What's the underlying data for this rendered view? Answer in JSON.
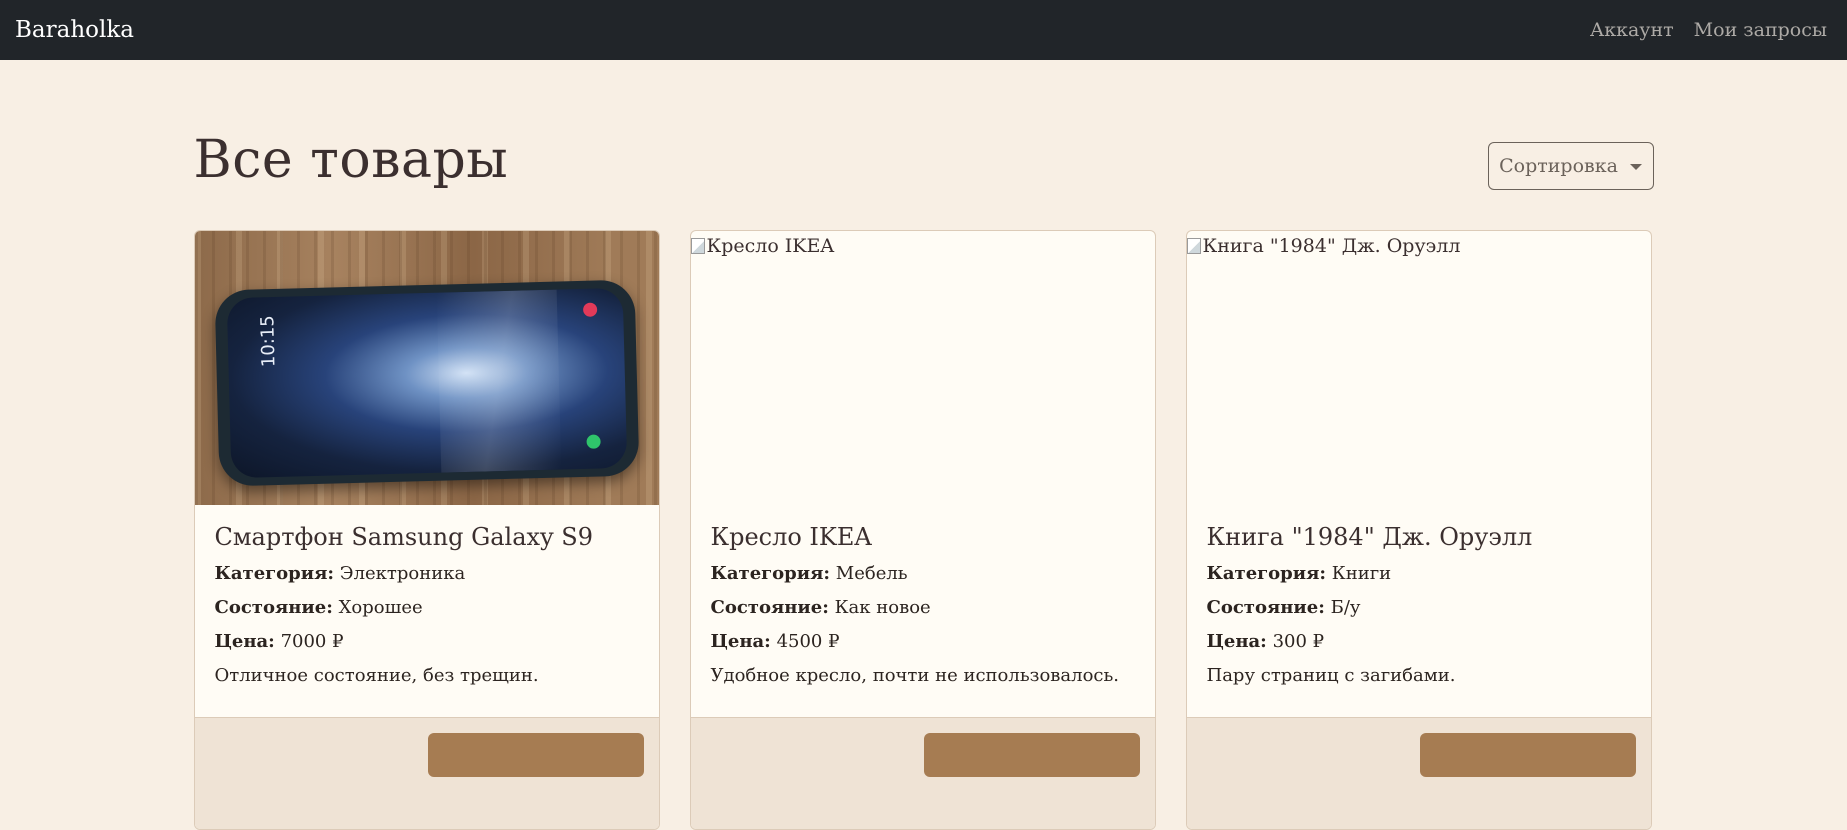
{
  "navbar": {
    "brand": "Baraholka",
    "links": [
      "Аккаунт",
      "Мои запросы"
    ]
  },
  "page": {
    "title": "Все товары",
    "sort_label": "Сортировка"
  },
  "labels": {
    "category": "Категория:",
    "condition": "Состояние:",
    "price": "Цена:"
  },
  "products": [
    {
      "title": "Смартфон Samsung Galaxy S9",
      "category": "Электроника",
      "condition": "Хорошее",
      "price": "7000 ₽",
      "description": "Отличное состояние, без трещин.",
      "image_alt": "",
      "screen_time": "10:15"
    },
    {
      "title": "Кресло IKEA",
      "category": "Мебель",
      "condition": "Как новое",
      "price": "4500 ₽",
      "description": "Удобное кресло, почти не использовалось.",
      "image_alt": "Кресло IKEA"
    },
    {
      "title": "Книга \"1984\" Дж. Оруэлл",
      "category": "Книги",
      "condition": "Б/у",
      "price": "300 ₽",
      "description": "Пару страниц с загибами.",
      "image_alt": "Книга \"1984\" Дж. Оруэлл"
    }
  ],
  "colors": {
    "background": "#f8efe4",
    "navbar": "#212529",
    "button": "#a67c52"
  }
}
